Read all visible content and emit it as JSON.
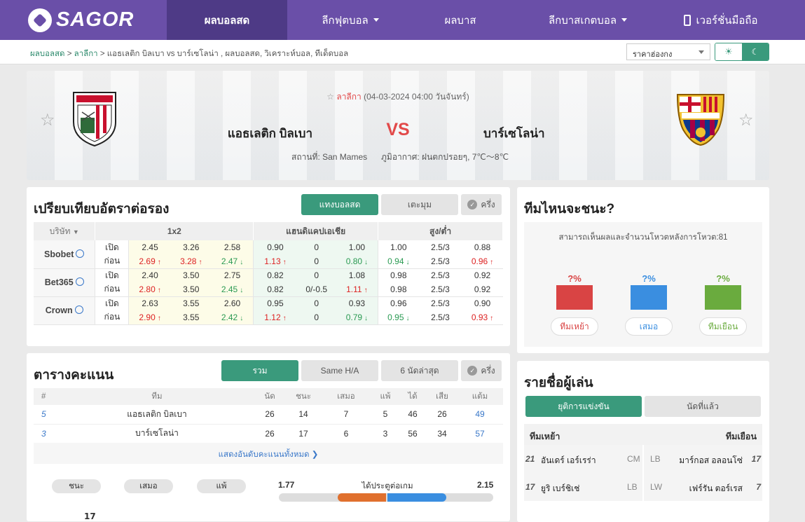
{
  "nav": {
    "logo": "SAGOR",
    "items": [
      {
        "label": "ผลบอลสด"
      },
      {
        "label": "ลีกฟุตบอล"
      },
      {
        "label": "ผลบาส"
      },
      {
        "label": "ลีกบาสเกตบอล"
      },
      {
        "label": "เวอร์ชั่นมือถือ"
      }
    ]
  },
  "breadcrumb": {
    "home": "ผลบอลสด",
    "league": "ลาลีกา",
    "current": "แอธเลติก บิลเบา vs บาร์เซโลน่า , ผลบอลสด, วิเคราะห์บอล, ทีเด็ดบอล"
  },
  "odds_select": "ราคาฮ่องกง",
  "theme": {
    "light": "☀",
    "dark": "☾"
  },
  "match": {
    "league": "ลาลีกา",
    "datetime": "(04-03-2024 04:00 วันจันทร์)",
    "home": "แอธเลติก บิลเบา",
    "away": "บาร์เซโลน่า",
    "vs": "VS",
    "venue": "สถานที่: San Mames",
    "weather": "ภูมิอากาศ: ฝนตกปรอยๆ, 7℃～8℃"
  },
  "odds": {
    "title": "เปรียบเทียบอัตราต่อรอง",
    "tabs": [
      "แทงบอลสด",
      "เตะมุม",
      "ครึ่ง"
    ],
    "headers": [
      "บริษัท",
      "1x2",
      "แฮนดิแคปเอเชีย",
      "สูง/ต่ำ"
    ],
    "rows": [
      {
        "company": "Sbobet",
        "open": [
          "เปิด",
          "2.45",
          "3.26",
          "2.58",
          "0.90",
          "0",
          "1.00",
          "1.00",
          "2.5/3",
          "0.88"
        ],
        "close": [
          "ก่อน",
          "2.69",
          "3.28",
          "2.47",
          "1.13",
          "0",
          "0.80",
          "0.94",
          "2.5/3",
          "0.96"
        ]
      },
      {
        "company": "Bet365",
        "open": [
          "เปิด",
          "2.40",
          "3.50",
          "2.75",
          "0.82",
          "0",
          "1.08",
          "0.98",
          "2.5/3",
          "0.92"
        ],
        "close": [
          "ก่อน",
          "2.80",
          "3.50",
          "2.45",
          "0.82",
          "0/-0.5",
          "1.11",
          "0.98",
          "2.5/3",
          "0.92"
        ]
      },
      {
        "company": "Crown",
        "open": [
          "เปิด",
          "2.63",
          "3.55",
          "2.60",
          "0.95",
          "0",
          "0.93",
          "0.96",
          "2.5/3",
          "0.90"
        ],
        "close": [
          "ก่อน",
          "2.90",
          "3.55",
          "2.42",
          "1.12",
          "0",
          "0.79",
          "0.95",
          "2.5/3",
          "0.93"
        ]
      }
    ]
  },
  "standings": {
    "title": "ตารางคะแนน",
    "tabs": [
      "รวม",
      "Same H/A",
      "6 นัดล่าสุด",
      "ครึ่ง"
    ],
    "headers": [
      "#",
      "ทีม",
      "นัด",
      "ชนะ",
      "เสมอ",
      "แพ้",
      "ได้",
      "เสีย",
      "แต้ม"
    ],
    "rows": [
      [
        "5",
        "แอธเลติก บิลเบา",
        "26",
        "14",
        "7",
        "5",
        "46",
        "26",
        "49"
      ],
      [
        "3",
        "บาร์เซโลน่า",
        "26",
        "17",
        "6",
        "3",
        "56",
        "34",
        "57"
      ]
    ],
    "more": "แสดงอันดับคะแนนทั้งหมด ❯",
    "pills": [
      "ชนะ",
      "เสมอ",
      "แพ้"
    ],
    "goals_label": "ได้ประตูต่อเกม",
    "goals_home": "1.77",
    "goals_away": "2.15",
    "goals_home_share": 0.451,
    "bottom_partial": "17"
  },
  "prediction": {
    "title": "ทีมไหนจะชนะ?",
    "subtitle": "สามารถเห็นผลและจำนวนโหวตหลังการโหวต:81",
    "options": [
      {
        "pct": "?%",
        "label": "ทีมเหย้า",
        "color": "#d94444"
      },
      {
        "pct": "?%",
        "label": "เสมอ",
        "color": "#3a8ee0"
      },
      {
        "pct": "?%",
        "label": "ทีมเยือน",
        "color": "#6aab3e"
      }
    ]
  },
  "lineup": {
    "title": "รายชื่อผู้เล่น",
    "tabs": [
      "ยุติการแข่งขัน",
      "นัดที่แล้ว"
    ],
    "home_label": "ทีมเหย้า",
    "away_label": "ทีมเยือน",
    "rows": [
      {
        "hn": "21",
        "hname": "อันเดร์ เอร์เรร่า",
        "hpos": "CM",
        "apos": "LB",
        "aname": "มาร์กอส อลอนโซ่",
        "an": "17"
      },
      {
        "hn": "17",
        "hname": "ยูริ เบร์ชิเช่",
        "hpos": "LB",
        "apos": "LW",
        "aname": "เฟร์รัน ตอร์เรส",
        "an": "7"
      }
    ]
  }
}
